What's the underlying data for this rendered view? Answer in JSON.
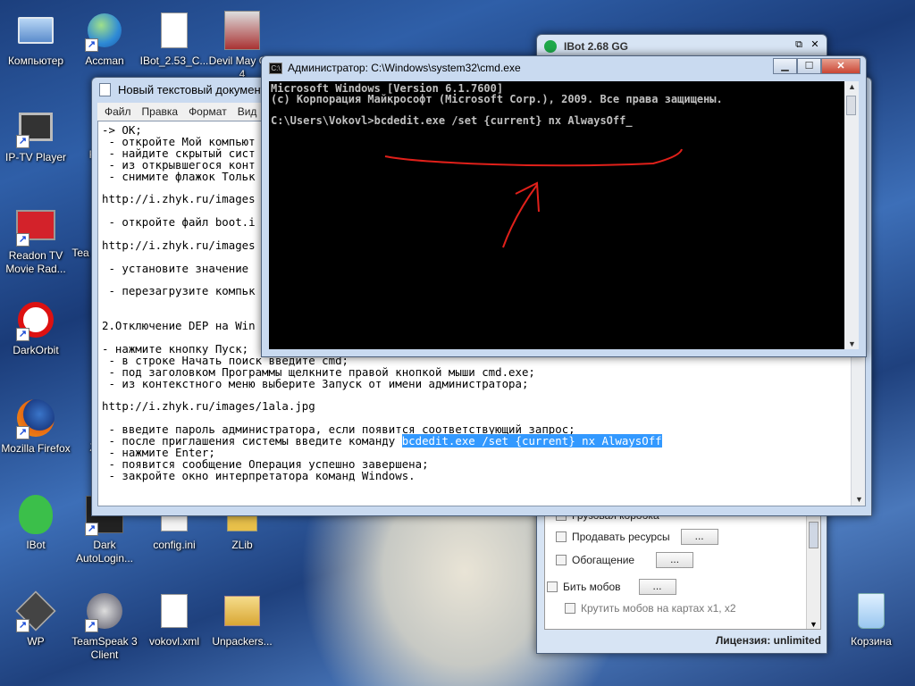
{
  "desktop_icons": [
    {
      "label": "Компьютер",
      "name": "computer-icon"
    },
    {
      "label": "Accman",
      "name": "accman-icon"
    },
    {
      "label": "IBot_2.53_C...",
      "name": "document-icon"
    },
    {
      "label": "Devil May C... 4",
      "name": "game-icon"
    },
    {
      "label": "IP-TV Player",
      "name": "tv-icon"
    },
    {
      "label": "Readon TV Movie Rad...",
      "name": "monitor-icon"
    },
    {
      "label": "DarkOrbit",
      "name": "prohibited-icon"
    },
    {
      "label": "Mozilla Firefox",
      "name": "firefox-icon"
    },
    {
      "label": "IBot",
      "name": "alien-icon"
    },
    {
      "label": "Dark AutoLogin...",
      "name": "autologin-icon"
    },
    {
      "label": "config.ini",
      "name": "config-icon"
    },
    {
      "label": "ZLib",
      "name": "zlib-icon"
    },
    {
      "label": "WP",
      "name": "wp-icon"
    },
    {
      "label": "TeamSpeak 3 Client",
      "name": "teamspeak-icon"
    },
    {
      "label": "vokovl.xml",
      "name": "xml-icon"
    },
    {
      "label": "Unpackers...",
      "name": "folder-icon"
    },
    {
      "label": "Корзина",
      "name": "recycle-bin-icon"
    }
  ],
  "partial_labels": {
    "r": "R",
    "team": "Tea",
    "z": "Z"
  },
  "ibot": {
    "title": "IBot 2.68 GG",
    "items": [
      {
        "label": "Грузовая коробка"
      },
      {
        "label": "Продавать ресурсы",
        "btn": "..."
      },
      {
        "label": "Обогащение",
        "btn": "..."
      },
      {
        "label": "Бить мобов",
        "btn": "..."
      },
      {
        "label": "Крутить мобов на картах x1, x2"
      }
    ],
    "license_label": "Лицензия:",
    "license_value": "unlimited"
  },
  "notepad": {
    "title": "Новый текстовый документ.txt",
    "menu": [
      "Файл",
      "Правка",
      "Формат",
      "Вид"
    ],
    "lines": [
      "-> OK;",
      " - откройте Мой компьют",
      " - найдите скрытый сист",
      " - из открывшегося конт",
      " - снимите флажок Тольк",
      "",
      "http://i.zhyk.ru/images",
      "",
      " - откройте файл boot.i",
      "",
      "http://i.zhyk.ru/images",
      "",
      " - установите значение",
      "",
      " - перезагрузите компьк",
      "",
      "",
      "2.Отключение DEP на Win",
      "",
      "- нажмите кнопку Пуск;",
      " - в строке Начать поиск введите cmd;",
      " - под заголовком Программы щелкните правой кнопкой мыши cmd.exe;",
      " - из контекстного меню выберите Запуск от имени администратора;",
      "",
      "http://i.zhyk.ru/images/1ala.jpg",
      "",
      " - введите пароль администратора, если появится соответствующий запрос;",
      " - после приглашения системы введите команду ",
      " - нажмите Enter;",
      " - появится сообщение Операция успешно завершена;",
      " - закройте окно интерпретатора команд Windows."
    ],
    "highlight": "bcdedit.exe /set {current} nx AlwaysOff"
  },
  "cmd": {
    "title": "Администратор: C:\\Windows\\system32\\cmd.exe",
    "lines": [
      "Microsoft Windows [Version 6.1.7600]",
      "(c) Корпорация Майкрософт (Microsoft Corp.), 2009. Все права защищены.",
      "",
      "C:\\Users\\Vokovl>bcdedit.exe /set {current} nx AlwaysOff_"
    ]
  },
  "colors": {
    "annotation": "#e0201a",
    "highlight": "#3399ff",
    "console_bg": "#000000"
  }
}
